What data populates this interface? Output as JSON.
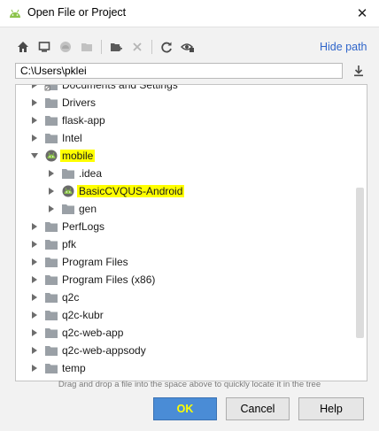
{
  "window": {
    "title": "Open File or Project",
    "close_glyph": "✕"
  },
  "toolbar": {
    "icons": [
      "home-icon",
      "desktop-icon",
      "android-project-icon",
      "project-folder-icon",
      "new-folder-icon",
      "delete-icon",
      "refresh-icon",
      "show-hidden-icon"
    ],
    "hide_path_label": "Hide path"
  },
  "path": {
    "value": "C:\\Users\\pklei"
  },
  "tree": {
    "items": [
      {
        "label": "Documents and Settings",
        "expanded": false,
        "icon": "folder-link-icon"
      },
      {
        "label": "Drivers",
        "expanded": false,
        "icon": "folder-icon"
      },
      {
        "label": "flask-app",
        "expanded": false,
        "icon": "folder-icon"
      },
      {
        "label": "Intel",
        "expanded": false,
        "icon": "folder-icon"
      },
      {
        "label": "mobile",
        "expanded": true,
        "icon": "android-icon",
        "highlight": true
      },
      {
        "label": ".idea",
        "expanded": false,
        "icon": "folder-icon"
      },
      {
        "label": "BasicCVQUS-Android",
        "expanded": false,
        "icon": "android-icon",
        "highlight": true
      },
      {
        "label": "gen",
        "expanded": false,
        "icon": "folder-icon"
      },
      {
        "label": "PerfLogs",
        "expanded": false,
        "icon": "folder-icon"
      },
      {
        "label": "pfk",
        "expanded": false,
        "icon": "folder-icon"
      },
      {
        "label": "Program Files",
        "expanded": false,
        "icon": "folder-icon"
      },
      {
        "label": "Program Files (x86)",
        "expanded": false,
        "icon": "folder-icon"
      },
      {
        "label": "q2c",
        "expanded": false,
        "icon": "folder-icon"
      },
      {
        "label": "q2c-kubr",
        "expanded": false,
        "icon": "folder-icon"
      },
      {
        "label": "q2c-web-app",
        "expanded": false,
        "icon": "folder-icon"
      },
      {
        "label": "q2c-web-appsody",
        "expanded": false,
        "icon": "folder-icon"
      },
      {
        "label": "temp",
        "expanded": false,
        "icon": "folder-icon"
      }
    ]
  },
  "hint": "Drag and drop a file into the space above to quickly locate it in the tree",
  "buttons": {
    "ok": "OK",
    "cancel": "Cancel",
    "help": "Help"
  },
  "colors": {
    "accent": "#2f65ca",
    "highlight": "#ffff00",
    "android_green": "#8bc34a",
    "folder": "#9aa0a6"
  }
}
